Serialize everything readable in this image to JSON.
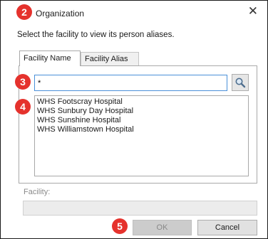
{
  "dialog": {
    "title": "Organization",
    "instruction": "Select the facility to view its person aliases.",
    "close_glyph": "✕"
  },
  "tabs": [
    {
      "label": "Facility Name",
      "active": true
    },
    {
      "label": "Facility Alias",
      "active": false
    }
  ],
  "search": {
    "value": "*"
  },
  "results": [
    "WHS Footscray Hospital",
    "WHS Sunbury Day Hospital",
    "WHS Sunshine Hospital",
    "WHS Williamstown Hospital"
  ],
  "facility": {
    "label": "Facility:",
    "value": ""
  },
  "buttons": {
    "ok": "OK",
    "cancel": "Cancel"
  },
  "callouts": {
    "title": "2",
    "search": "3",
    "list": "4",
    "ok": "5"
  },
  "colors": {
    "callout": "#e5322d",
    "focus_border": "#4a90d9"
  },
  "icons": {
    "search": "magnifier-icon",
    "close": "close-icon"
  }
}
